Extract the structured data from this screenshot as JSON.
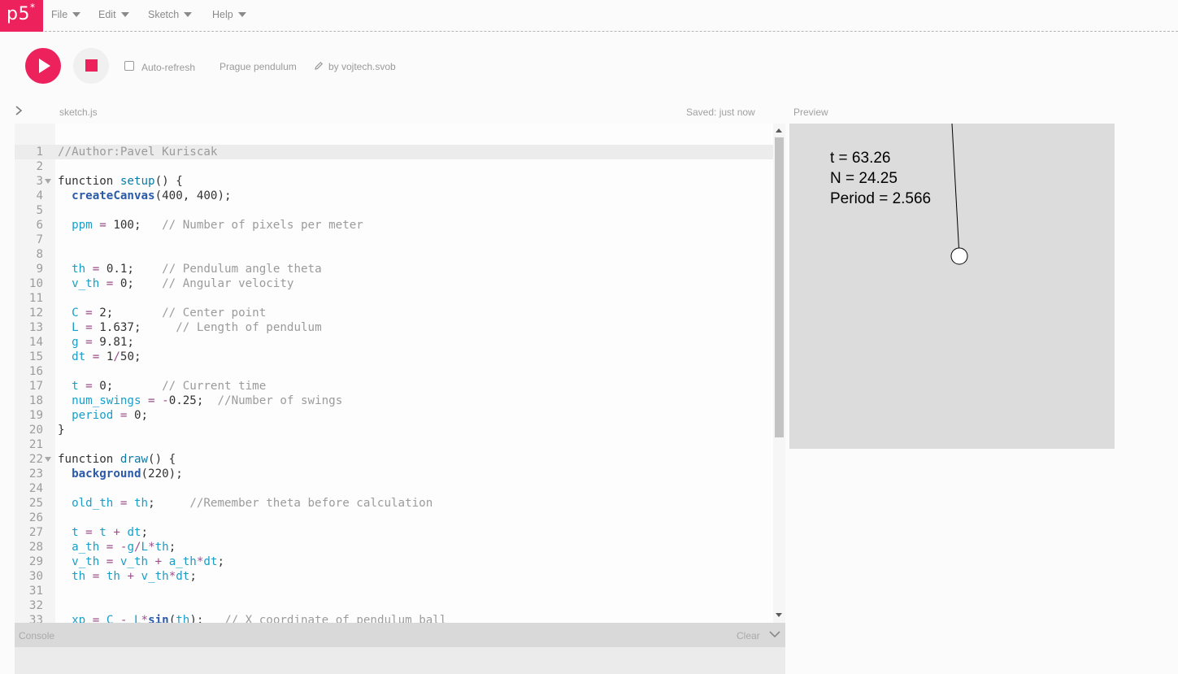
{
  "logo": {
    "text": "p5",
    "mark": "*"
  },
  "menu": [
    {
      "label": "File"
    },
    {
      "label": "Edit"
    },
    {
      "label": "Sketch"
    },
    {
      "label": "Help"
    }
  ],
  "toolbar": {
    "auto_refresh_label": "Auto-refresh",
    "auto_refresh_checked": false,
    "project_name": "Prague pendulum",
    "author": "by vojtech.svob"
  },
  "editor": {
    "file_name": "sketch.js",
    "saved_status": "Saved: just now",
    "active_line": 1,
    "lines": [
      {
        "n": "1",
        "fold": false,
        "tokens": [
          [
            "cm",
            "//Author:Pavel Kuriscak"
          ]
        ]
      },
      {
        "n": "2",
        "fold": false,
        "tokens": []
      },
      {
        "n": "3",
        "fold": true,
        "tokens": [
          [
            "kw",
            "function "
          ],
          [
            "fn",
            "setup"
          ],
          [
            "kw",
            "() {"
          ]
        ]
      },
      {
        "n": "4",
        "fold": false,
        "tokens": [
          [
            "kw",
            "  "
          ],
          [
            "bf",
            "createCanvas"
          ],
          [
            "kw",
            "(400, 400);"
          ]
        ]
      },
      {
        "n": "5",
        "fold": false,
        "tokens": []
      },
      {
        "n": "6",
        "fold": false,
        "tokens": [
          [
            "kw",
            "  "
          ],
          [
            "vr",
            "ppm"
          ],
          [
            "op",
            " = "
          ],
          [
            "kw",
            "100;   "
          ],
          [
            "cm",
            "// Number of pixels per meter"
          ]
        ]
      },
      {
        "n": "7",
        "fold": false,
        "tokens": []
      },
      {
        "n": "8",
        "fold": false,
        "tokens": []
      },
      {
        "n": "9",
        "fold": false,
        "tokens": [
          [
            "kw",
            "  "
          ],
          [
            "vr",
            "th"
          ],
          [
            "op",
            " = "
          ],
          [
            "kw",
            "0.1;    "
          ],
          [
            "cm",
            "// Pendulum angle theta"
          ]
        ]
      },
      {
        "n": "10",
        "fold": false,
        "tokens": [
          [
            "kw",
            "  "
          ],
          [
            "vr",
            "v_th"
          ],
          [
            "op",
            " = "
          ],
          [
            "kw",
            "0;    "
          ],
          [
            "cm",
            "// Angular velocity"
          ]
        ]
      },
      {
        "n": "11",
        "fold": false,
        "tokens": []
      },
      {
        "n": "12",
        "fold": false,
        "tokens": [
          [
            "kw",
            "  "
          ],
          [
            "vr",
            "C"
          ],
          [
            "op",
            " = "
          ],
          [
            "kw",
            "2;       "
          ],
          [
            "cm",
            "// Center point"
          ]
        ]
      },
      {
        "n": "13",
        "fold": false,
        "tokens": [
          [
            "kw",
            "  "
          ],
          [
            "vr",
            "L"
          ],
          [
            "op",
            " = "
          ],
          [
            "kw",
            "1.637;     "
          ],
          [
            "cm",
            "// Length of pendulum"
          ]
        ]
      },
      {
        "n": "14",
        "fold": false,
        "tokens": [
          [
            "kw",
            "  "
          ],
          [
            "vr",
            "g"
          ],
          [
            "op",
            " = "
          ],
          [
            "kw",
            "9.81;"
          ]
        ]
      },
      {
        "n": "15",
        "fold": false,
        "tokens": [
          [
            "kw",
            "  "
          ],
          [
            "vr",
            "dt"
          ],
          [
            "op",
            " = "
          ],
          [
            "kw",
            "1"
          ],
          [
            "op",
            "/"
          ],
          [
            "kw",
            "50;"
          ]
        ]
      },
      {
        "n": "16",
        "fold": false,
        "tokens": []
      },
      {
        "n": "17",
        "fold": false,
        "tokens": [
          [
            "kw",
            "  "
          ],
          [
            "vr",
            "t"
          ],
          [
            "op",
            " = "
          ],
          [
            "kw",
            "0;       "
          ],
          [
            "cm",
            "// Current time"
          ]
        ]
      },
      {
        "n": "18",
        "fold": false,
        "tokens": [
          [
            "kw",
            "  "
          ],
          [
            "vr",
            "num_swings"
          ],
          [
            "op",
            " = -"
          ],
          [
            "kw",
            "0.25;  "
          ],
          [
            "cm",
            "//Number of swings"
          ]
        ]
      },
      {
        "n": "19",
        "fold": false,
        "tokens": [
          [
            "kw",
            "  "
          ],
          [
            "vr",
            "period"
          ],
          [
            "op",
            " = "
          ],
          [
            "kw",
            "0;"
          ]
        ]
      },
      {
        "n": "20",
        "fold": false,
        "tokens": [
          [
            "kw",
            "}"
          ]
        ]
      },
      {
        "n": "21",
        "fold": false,
        "tokens": []
      },
      {
        "n": "22",
        "fold": true,
        "tokens": [
          [
            "kw",
            "function "
          ],
          [
            "fn",
            "draw"
          ],
          [
            "kw",
            "() {"
          ]
        ]
      },
      {
        "n": "23",
        "fold": false,
        "tokens": [
          [
            "kw",
            "  "
          ],
          [
            "bf",
            "background"
          ],
          [
            "kw",
            "(220);"
          ]
        ]
      },
      {
        "n": "24",
        "fold": false,
        "tokens": []
      },
      {
        "n": "25",
        "fold": false,
        "tokens": [
          [
            "kw",
            "  "
          ],
          [
            "vr",
            "old_th"
          ],
          [
            "op",
            " = "
          ],
          [
            "vr",
            "th"
          ],
          [
            "kw",
            ";     "
          ],
          [
            "cm",
            "//Remember theta before calculation"
          ]
        ]
      },
      {
        "n": "26",
        "fold": false,
        "tokens": []
      },
      {
        "n": "27",
        "fold": false,
        "tokens": [
          [
            "kw",
            "  "
          ],
          [
            "vr",
            "t"
          ],
          [
            "op",
            " = "
          ],
          [
            "vr",
            "t"
          ],
          [
            "op",
            " + "
          ],
          [
            "vr",
            "dt"
          ],
          [
            "kw",
            ";"
          ]
        ]
      },
      {
        "n": "28",
        "fold": false,
        "tokens": [
          [
            "kw",
            "  "
          ],
          [
            "vr",
            "a_th"
          ],
          [
            "op",
            " = -"
          ],
          [
            "vr",
            "g"
          ],
          [
            "op",
            "/"
          ],
          [
            "vr",
            "L"
          ],
          [
            "op",
            "*"
          ],
          [
            "vr",
            "th"
          ],
          [
            "kw",
            ";"
          ]
        ]
      },
      {
        "n": "29",
        "fold": false,
        "tokens": [
          [
            "kw",
            "  "
          ],
          [
            "vr",
            "v_th"
          ],
          [
            "op",
            " = "
          ],
          [
            "vr",
            "v_th"
          ],
          [
            "op",
            " + "
          ],
          [
            "vr",
            "a_th"
          ],
          [
            "op",
            "*"
          ],
          [
            "vr",
            "dt"
          ],
          [
            "kw",
            ";"
          ]
        ]
      },
      {
        "n": "30",
        "fold": false,
        "tokens": [
          [
            "kw",
            "  "
          ],
          [
            "vr",
            "th"
          ],
          [
            "op",
            " = "
          ],
          [
            "vr",
            "th"
          ],
          [
            "op",
            " + "
          ],
          [
            "vr",
            "v_th"
          ],
          [
            "op",
            "*"
          ],
          [
            "vr",
            "dt"
          ],
          [
            "kw",
            ";"
          ]
        ]
      },
      {
        "n": "31",
        "fold": false,
        "tokens": []
      },
      {
        "n": "32",
        "fold": false,
        "tokens": []
      },
      {
        "n": "33",
        "fold": false,
        "tokens": [
          [
            "kw",
            "  "
          ],
          [
            "vr",
            "xp"
          ],
          [
            "op",
            " = "
          ],
          [
            "vr",
            "C"
          ],
          [
            "op",
            " - "
          ],
          [
            "vr",
            "L"
          ],
          [
            "op",
            "*"
          ],
          [
            "bf",
            "sin"
          ],
          [
            "kw",
            "("
          ],
          [
            "vr",
            "th"
          ],
          [
            "kw",
            ");   "
          ],
          [
            "cm",
            "// X coordinate of pendulum ball"
          ]
        ]
      }
    ]
  },
  "console": {
    "label": "Console",
    "clear_label": "Clear"
  },
  "preview": {
    "label": "Preview",
    "lines": [
      "t = 63.26",
      "N = 24.25",
      "Period = 2.566"
    ]
  },
  "colors": {
    "accent": "#ed225d"
  }
}
